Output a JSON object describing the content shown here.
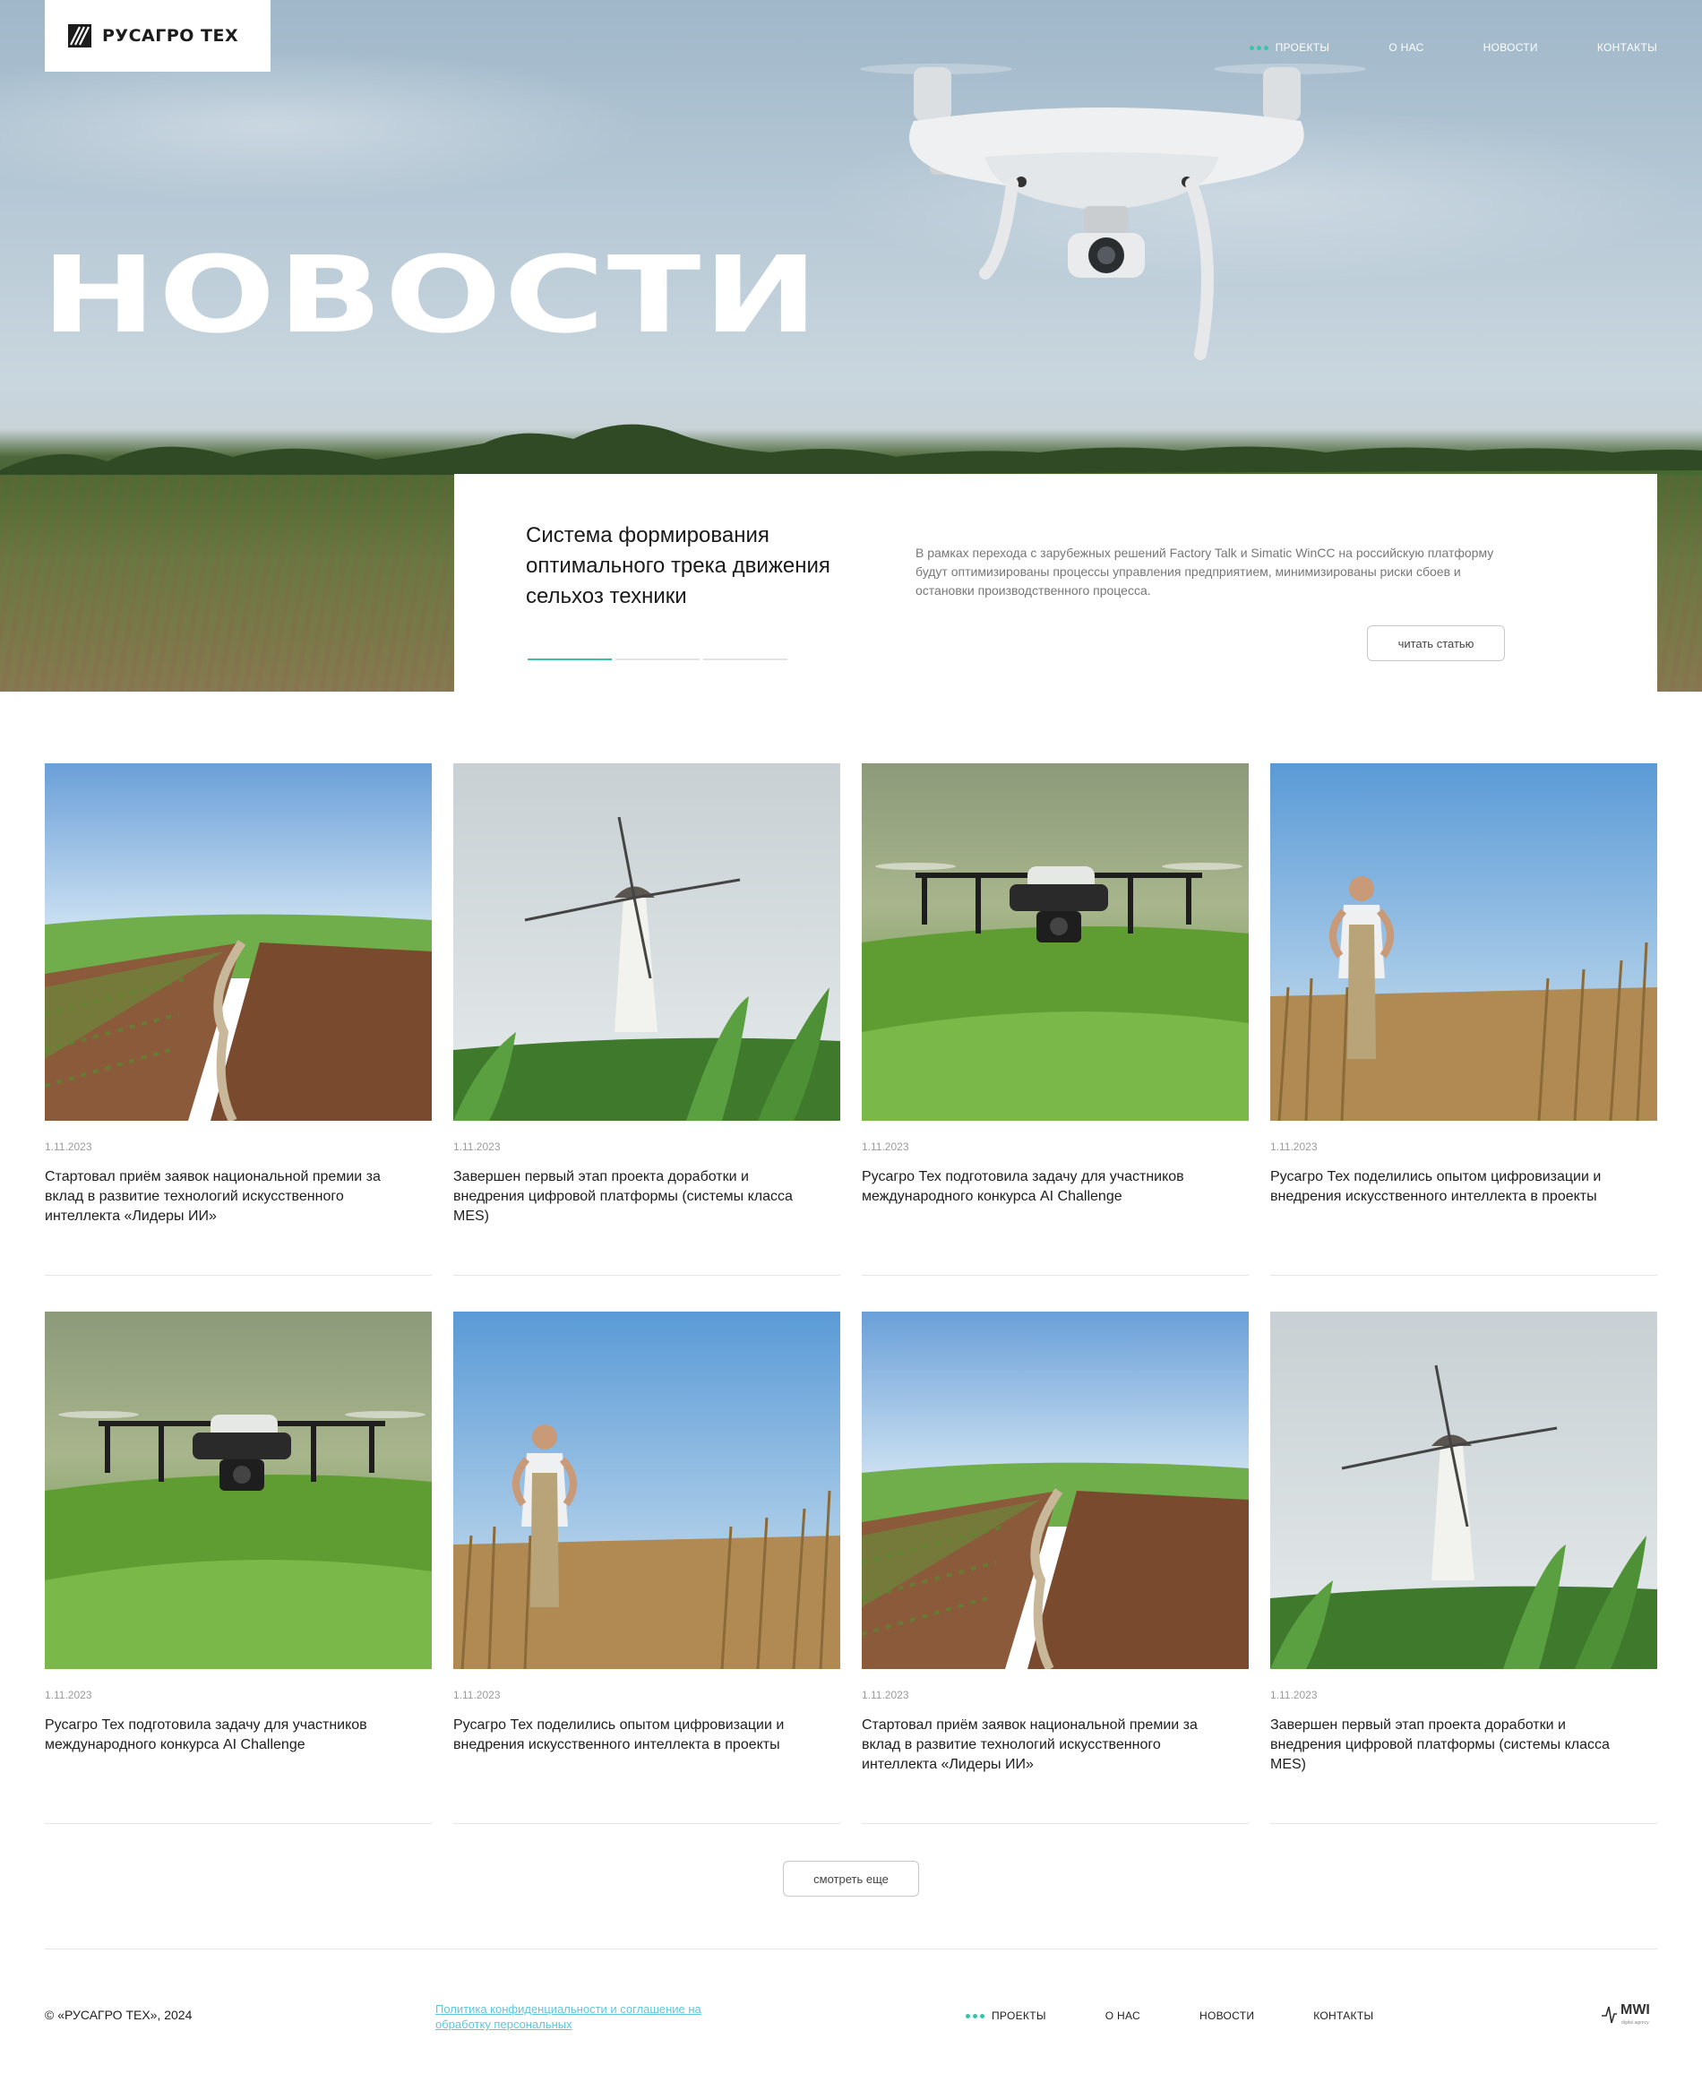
{
  "brand": {
    "name": "РУСАГРО ТЕХ"
  },
  "nav": {
    "items": [
      {
        "label": "ПРОЕКТЫ"
      },
      {
        "label": "О НАС"
      },
      {
        "label": "НОВОСТИ"
      },
      {
        "label": "КОНТАКТЫ"
      }
    ]
  },
  "hero": {
    "title": "НОВОСТИ"
  },
  "featured": {
    "title": "Система формирования оптимального трека движения сельхоз техники",
    "description": "В рамках перехода с зарубежных решений Factory Talk и Simatic WinCC на российскую платформу будут оптимизированы процессы управления предприятием, минимизированы риски сбоев и остановки производственного процесса.",
    "button": "читать статью",
    "slides_total": 3,
    "slide_active": 1
  },
  "news": [
    {
      "date": "1.11.2023",
      "title": "Стартовал приём заявок национальной премии за вклад в развитие технологий искусственного интеллекта «Лидеры ИИ»",
      "image": "field-path"
    },
    {
      "date": "1.11.2023",
      "title": "Завершен первый этап проекта доработки и внедрения цифровой платформы (системы класса MES)",
      "image": "windmill"
    },
    {
      "date": "1.11.2023",
      "title": "Русагро Тех подготовила задачу для участников международного конкурса AI Challenge",
      "image": "drone"
    },
    {
      "date": "1.11.2023",
      "title": "Русагро Тех поделились опытом цифровизации и внедрения искусственного интеллекта в проекты",
      "image": "farmer"
    },
    {
      "date": "1.11.2023",
      "title": "Русагро Тех подготовила задачу для участников международного конкурса AI Challenge",
      "image": "drone"
    },
    {
      "date": "1.11.2023",
      "title": "Русагро Тех поделились опытом цифровизации и внедрения искусственного интеллекта в проекты",
      "image": "farmer"
    },
    {
      "date": "1.11.2023",
      "title": "Стартовал приём заявок национальной премии за вклад в развитие технологий искусственного интеллекта «Лидеры ИИ»",
      "image": "field-path"
    },
    {
      "date": "1.11.2023",
      "title": "Завершен первый этап проекта доработки и внедрения цифровой платформы (системы класса MES)",
      "image": "windmill"
    }
  ],
  "more_button": "смотреть еще",
  "footer": {
    "copyright": "© «РУСАГРО ТЕХ», 2024",
    "policy": "Политика конфиденциальности и соглашение на обработку персональных",
    "agency": "MWI",
    "agency_sub": "digital agency"
  },
  "colors": {
    "accent": "#36c3a8",
    "link": "#5ec6dc"
  }
}
